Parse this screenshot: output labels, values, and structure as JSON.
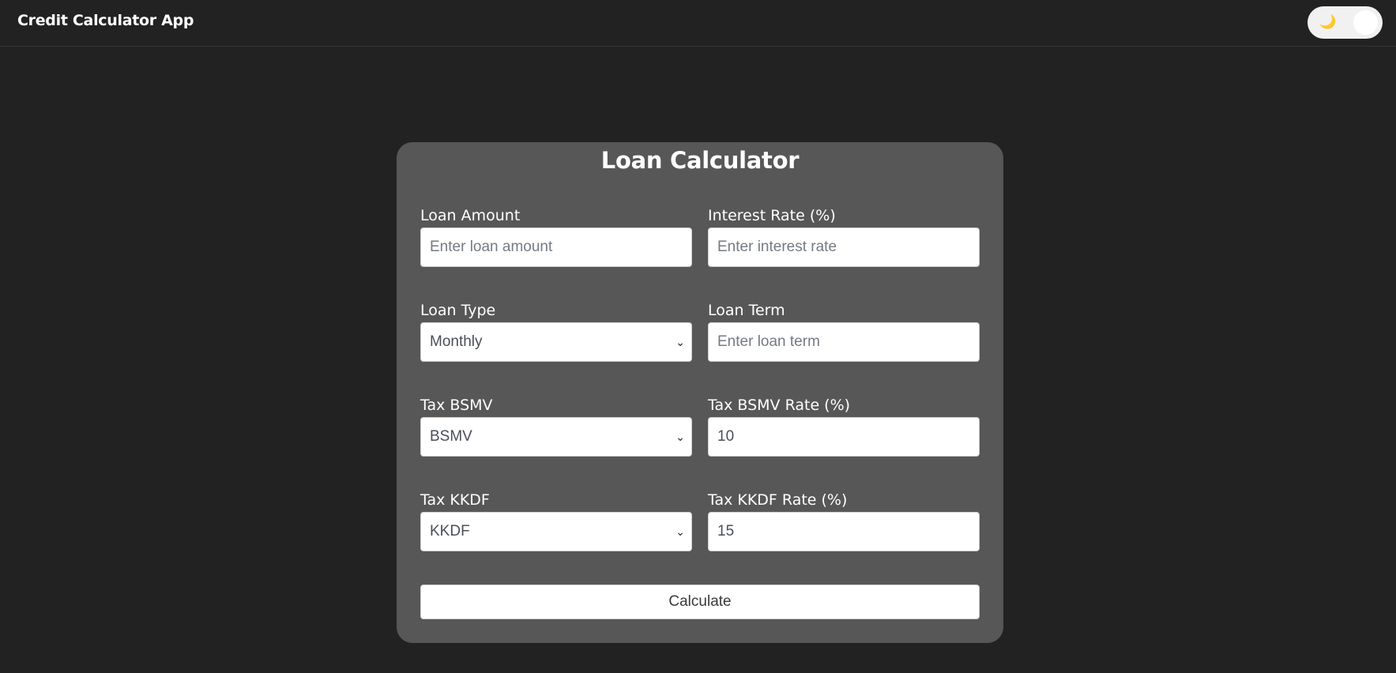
{
  "header": {
    "title": "Credit Calculator App",
    "theme_toggle": {
      "icon": "moon-icon",
      "glyph": "🌙",
      "state": "off"
    }
  },
  "form": {
    "title": "Loan Calculator",
    "loan_amount": {
      "label": "Loan Amount",
      "value": "",
      "placeholder": "Enter loan amount"
    },
    "interest_rate": {
      "label": "Interest Rate (%)",
      "value": "",
      "placeholder": "Enter interest rate"
    },
    "loan_type": {
      "label": "Loan Type",
      "selected": "Monthly"
    },
    "loan_term": {
      "label": "Loan Term",
      "value": "",
      "placeholder": "Enter loan term"
    },
    "tax_bsmv": {
      "label": "Tax BSMV",
      "selected": "BSMV"
    },
    "tax_bsmv_rate": {
      "label": "Tax BSMV Rate (%)",
      "value": "10",
      "placeholder": ""
    },
    "tax_kkdf": {
      "label": "Tax KKDF",
      "selected": "KKDF"
    },
    "tax_kkdf_rate": {
      "label": "Tax KKDF Rate (%)",
      "value": "15",
      "placeholder": ""
    },
    "submit_label": "Calculate"
  },
  "colors": {
    "page_background": "#222222",
    "card_background": "#575757",
    "toggle_background": "#f1f1f1",
    "moon_color": "#f2c029"
  }
}
